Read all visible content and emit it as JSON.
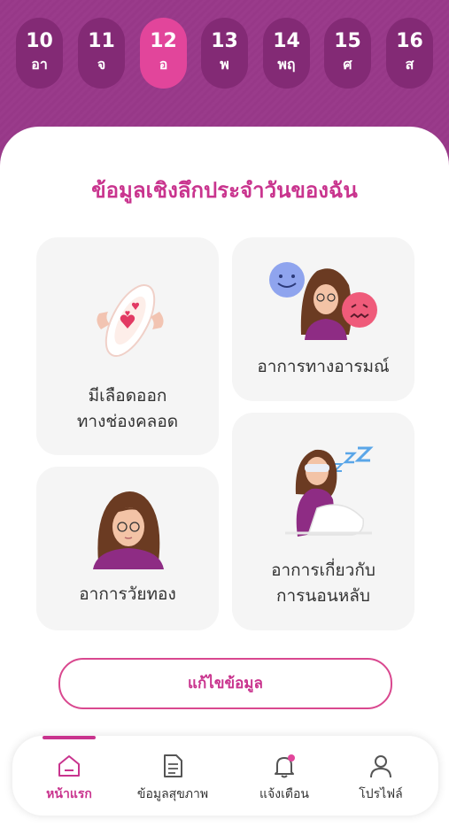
{
  "calendar": {
    "days": [
      {
        "num": "10",
        "weekday": "อา"
      },
      {
        "num": "11",
        "weekday": "จ"
      },
      {
        "num": "12",
        "weekday": "อ"
      },
      {
        "num": "13",
        "weekday": "พ"
      },
      {
        "num": "14",
        "weekday": "พฤ"
      },
      {
        "num": "15",
        "weekday": "ศ"
      },
      {
        "num": "16",
        "weekday": "ส"
      }
    ],
    "selected": "12"
  },
  "insights": {
    "title": "ข้อมูลเชิงลึกประจำวันของฉัน",
    "cards": {
      "bleeding": {
        "line1": "มีเลือดออก",
        "line2": "ทางช่องคลอด",
        "icon": "sanitary-pad-hearts-icon"
      },
      "mood": {
        "line1": "อาการทางอารมณ์",
        "icon": "mood-woman-emoji-icon"
      },
      "menopause": {
        "line1": "อาการวัยทอง",
        "icon": "woman-portrait-icon"
      },
      "sleep": {
        "line1": "อาการเกี่ยวกับ",
        "line2": "การนอนหลับ",
        "icon": "sleeping-woman-icon"
      }
    }
  },
  "edit_button": {
    "label": "แก้ไขข้อมูล"
  },
  "bottom_nav": {
    "items": [
      {
        "label": "หน้าแรก",
        "icon": "home-icon"
      },
      {
        "label": "ข้อมูลสุขภาพ",
        "icon": "document-icon"
      },
      {
        "label": "แจ้งเตือน",
        "icon": "bell-icon"
      },
      {
        "label": "โปรไฟล์",
        "icon": "profile-icon"
      }
    ]
  },
  "colors": {
    "brand": "#9a3b8b",
    "accent": "#e2459b",
    "title": "#c9348e"
  }
}
